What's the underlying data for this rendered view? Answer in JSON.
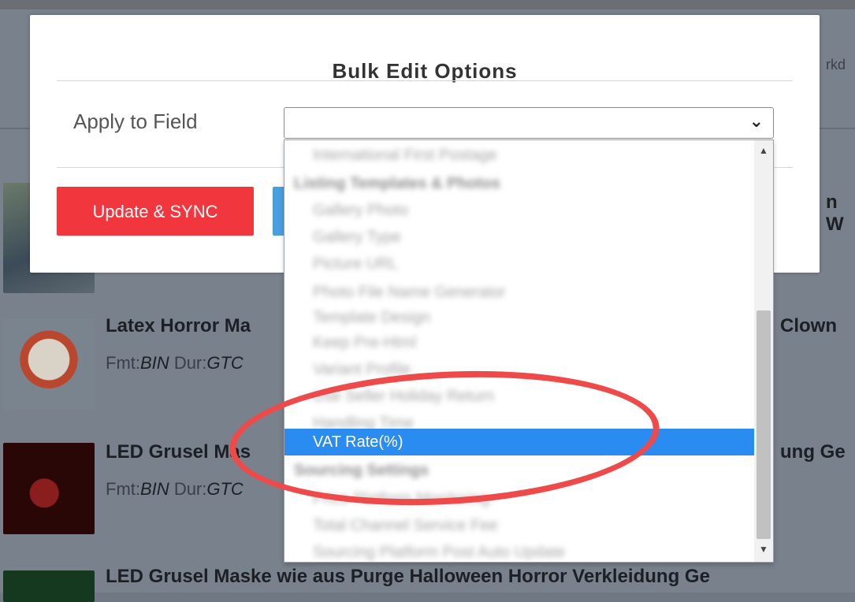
{
  "modal": {
    "title": "Bulk Edit Options",
    "apply_label": "Apply to Field",
    "select_value": "",
    "update_button": "Update & SYNC"
  },
  "dropdown": {
    "selected_option": "VAT Rate(%)"
  },
  "background": {
    "partial_right_top": "rkd",
    "partial_right_w": "n W",
    "items": [
      {
        "title": "Latex Horror Ma",
        "meta_fmt_label": "Fmt:",
        "meta_fmt": "BIN",
        "meta_dur_label": "Dur:",
        "meta_dur": "GTC",
        "right": "Clown"
      },
      {
        "title": "LED Grusel Mas",
        "meta_fmt_label": "Fmt:",
        "meta_fmt": "BIN",
        "meta_dur_label": "Dur:",
        "meta_dur": "GTC",
        "right": "ung Ge"
      },
      {
        "title": "LED Grusel Maske wie aus Purge Halloween Horror Verkleidung Ge"
      }
    ]
  },
  "colors": {
    "update_button": "#f2363e",
    "selected_option": "#2a8cf0",
    "highlight_circle": "#ee4a4a"
  }
}
